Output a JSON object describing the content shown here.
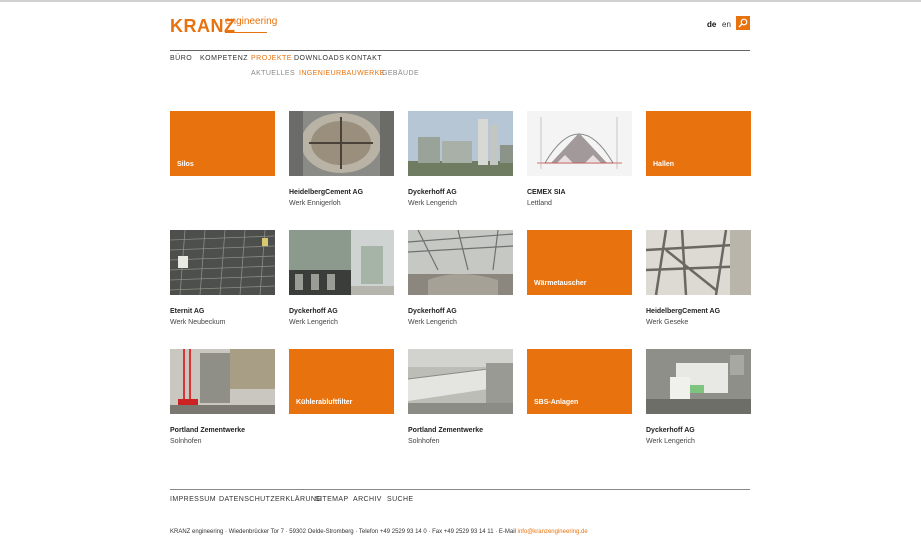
{
  "brand": {
    "logo_main": "KRANZ",
    "logo_sub": "engineering",
    "accent": "#e8720e"
  },
  "lang": {
    "de": "de",
    "en": "en"
  },
  "nav": {
    "main": [
      "BÜRO",
      "KOMPETENZ",
      "PROJEKTE",
      "DOWNLOADS",
      "KONTAKT"
    ],
    "active_main": "PROJEKTE",
    "sub": [
      "AKTUELLES",
      "INGENIEURBAUWERKE",
      "GEBÄUDE"
    ],
    "active_sub": "INGENIEURBAUWERKE"
  },
  "tiles": [
    {
      "type": "category",
      "label": "Silos"
    },
    {
      "type": "project",
      "title": "HeidelbergCement AG",
      "subtitle": "Werk Ennigerloh"
    },
    {
      "type": "project",
      "title": "Dyckerhoff AG",
      "subtitle": "Werk Lengerich"
    },
    {
      "type": "project",
      "title": "CEMEX SIA",
      "subtitle": "Lettland"
    },
    {
      "type": "category",
      "label": "Hallen"
    },
    {
      "type": "project",
      "title": "Eternit AG",
      "subtitle": "Werk Neubeckum"
    },
    {
      "type": "project",
      "title": "Dyckerhoff AG",
      "subtitle": "Werk Lengerich"
    },
    {
      "type": "project",
      "title": "Dyckerhoff AG",
      "subtitle": "Werk Lengerich"
    },
    {
      "type": "category",
      "label": "Wärmetauscher"
    },
    {
      "type": "project",
      "title": "HeidelbergCement AG",
      "subtitle": "Werk Geseke"
    },
    {
      "type": "project",
      "title": "Portland Zementwerke",
      "subtitle": "Solnhofen"
    },
    {
      "type": "category",
      "label": "Kühlerabluftfilter"
    },
    {
      "type": "project",
      "title": "Portland Zementwerke",
      "subtitle": "Solnhofen"
    },
    {
      "type": "category",
      "label": "SBS-Anlagen"
    },
    {
      "type": "project",
      "title": "Dyckerhoff AG",
      "subtitle": "Werk Lengerich"
    }
  ],
  "footer": {
    "links": [
      "IMPRESSUM",
      "DATENSCHUTZERKLÄRUNG",
      "SITEMAP",
      "ARCHIV",
      "SUCHE"
    ],
    "address": "KRANZ engineering · Wiedenbrücker Tor 7 · 59302 Oelde-Stromberg · Telefon +49 2529 93 14 0 · Fax +49 2529 93 14 11 · E-Mail ",
    "email": "info@kranzengineering.de"
  }
}
